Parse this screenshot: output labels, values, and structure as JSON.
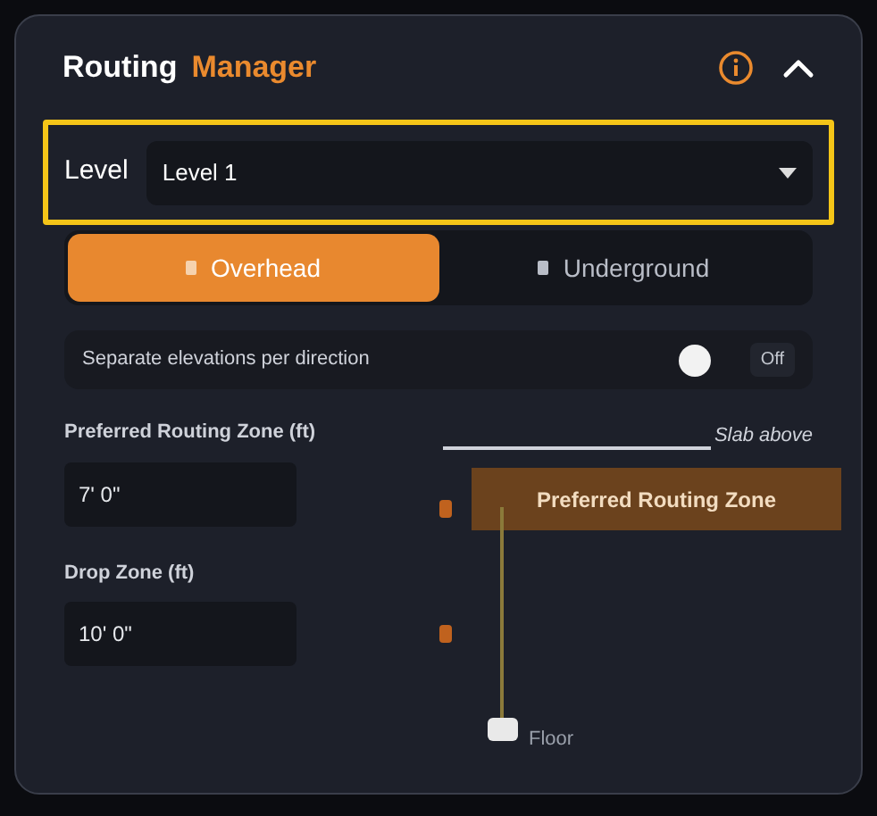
{
  "panel": {
    "title": "Routing",
    "title_accent": "Manager",
    "expanded": true
  },
  "level_select": {
    "label": "Level",
    "value": "Level 1",
    "focused": true
  },
  "mode_tabs": [
    {
      "label": "Overhead",
      "selected": true
    },
    {
      "label": "Underground",
      "selected": false
    }
  ],
  "separate_elevations": {
    "label": "Separate elevations per direction",
    "on": false,
    "value": "Off"
  },
  "fields": [
    {
      "label": "Preferred Routing Zone (ft)",
      "value": "7' 0\""
    },
    {
      "label": "Drop Zone (ft)",
      "value": "10' 0\""
    }
  ],
  "diagram": {
    "top_label": "Slab above",
    "zone_label": "Preferred Routing Zone",
    "bottom_label": "Floor"
  }
}
